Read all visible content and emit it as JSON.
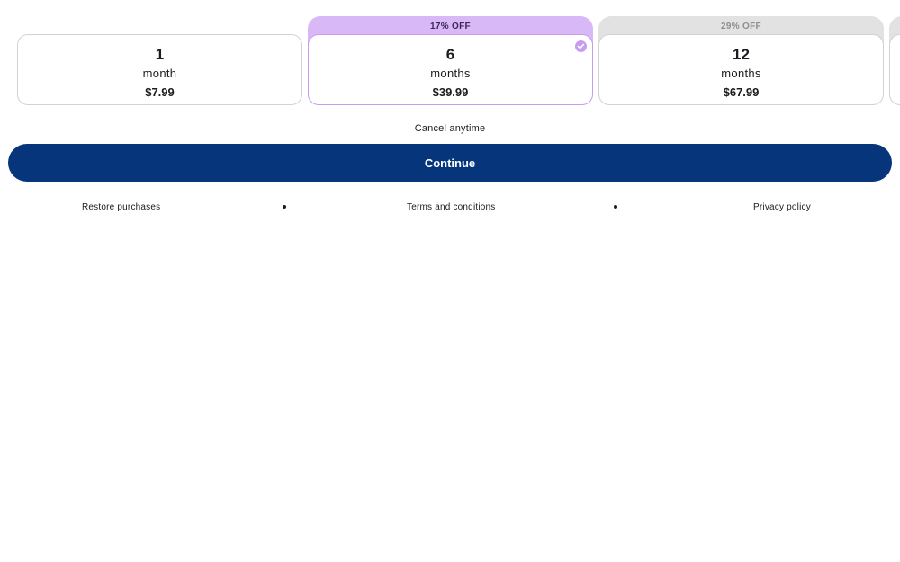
{
  "plans": [
    {
      "badge": "",
      "number": "1",
      "unit": "month",
      "price": "$7.99",
      "selected": false
    },
    {
      "badge": "17% OFF",
      "number": "6",
      "unit": "months",
      "price": "$39.99",
      "selected": true
    },
    {
      "badge": "29% OFF",
      "number": "12",
      "unit": "months",
      "price": "$67.99",
      "selected": false
    }
  ],
  "cancel_text": "Cancel anytime",
  "continue_label": "Continue",
  "footer": {
    "restore": "Restore purchases",
    "terms": "Terms and conditions",
    "privacy": "Privacy policy"
  },
  "icons": {
    "selected": "check-circle-icon"
  },
  "colors": {
    "primary": "#06357c",
    "selected_badge": "#d9b8f8",
    "selected_border": "#c99cf0",
    "unselected_badge": "#e2e2e2"
  }
}
